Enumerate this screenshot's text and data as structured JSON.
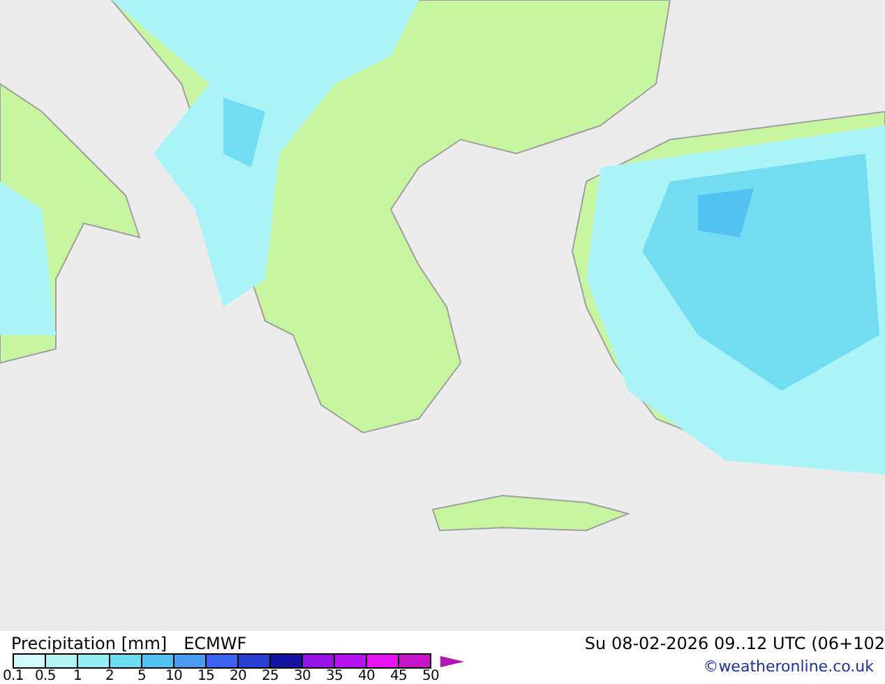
{
  "map": {
    "title": "Precipitation [mm]",
    "model": "ECMWF",
    "valid_time": "Su 08-02-2026 09..12 UTC (06+102",
    "credit": "©weatheronline.co.uk"
  },
  "legend": {
    "labels": [
      "0.1",
      "0.5",
      "1",
      "2",
      "5",
      "10",
      "15",
      "20",
      "25",
      "30",
      "35",
      "40",
      "45",
      "50"
    ],
    "bins": [
      {
        "color": "#d2fafa"
      },
      {
        "color": "#b4f4f4"
      },
      {
        "color": "#96eef2"
      },
      {
        "color": "#6edcf0"
      },
      {
        "color": "#52c2f0"
      },
      {
        "color": "#4a9cf0"
      },
      {
        "color": "#3c64f0"
      },
      {
        "color": "#2840d0"
      },
      {
        "color": "#1414a0"
      },
      {
        "color": "#9614e6"
      },
      {
        "color": "#b414f0"
      },
      {
        "color": "#e614f0"
      },
      {
        "color": "#c814c8"
      }
    ],
    "overflow": {
      "color": "#b414b4"
    }
  }
}
